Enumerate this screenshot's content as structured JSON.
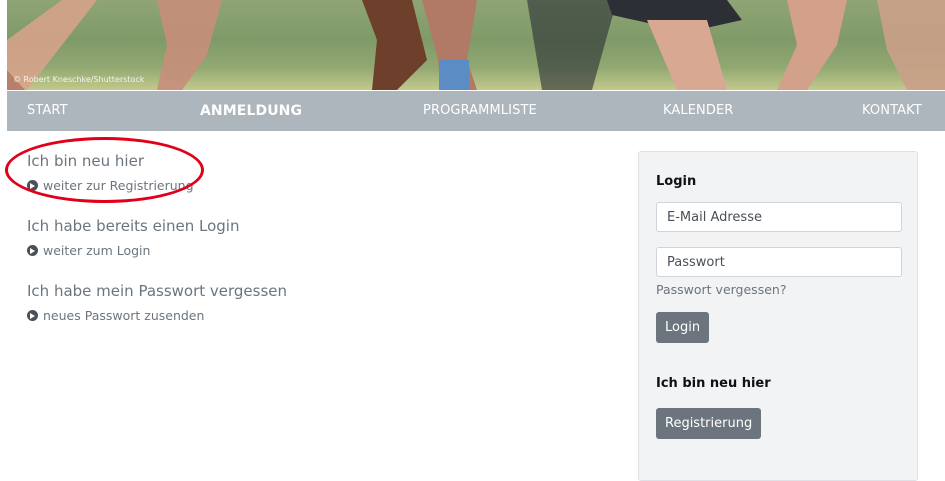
{
  "hero": {
    "credit": "© Robert Kneschke/Shutterstock"
  },
  "nav": {
    "items": [
      {
        "label": "START"
      },
      {
        "label": "ANMELDUNG",
        "active": true
      },
      {
        "label": "PROGRAMMLISTE"
      },
      {
        "label": "KALENDER"
      },
      {
        "label": "KONTAKT"
      }
    ]
  },
  "sections": [
    {
      "title": "Ich bin neu hier",
      "link": "weiter zur Registrierung"
    },
    {
      "title": "Ich habe bereits einen Login",
      "link": "weiter zum Login"
    },
    {
      "title": "Ich habe mein Passwort vergessen",
      "link": "neues Passwort zusenden"
    }
  ],
  "panel": {
    "login_heading": "Login",
    "email_placeholder": "E-Mail Adresse",
    "password_placeholder": "Passwort",
    "forgot_link": "Passwort vergessen?",
    "login_button": "Login",
    "new_heading": "Ich bin neu hier",
    "register_button": "Registrierung"
  },
  "colors": {
    "nav_bg": "#adb5bd",
    "button_bg": "#6c757d",
    "highlight": "#e0001a",
    "panel_bg": "#f1f3f5"
  },
  "icons": [
    "chevron-circle-right-icon"
  ]
}
